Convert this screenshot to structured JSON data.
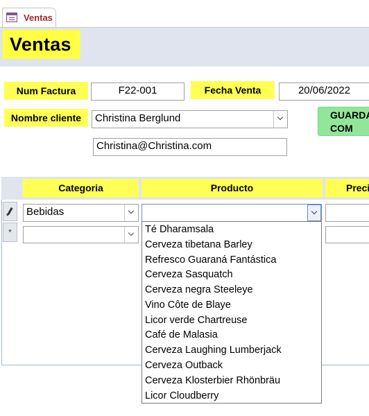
{
  "tab": {
    "label": "Ventas"
  },
  "form": {
    "title": "Ventas"
  },
  "invoice": {
    "num_label": "Num Factura",
    "num_value": "F22-001",
    "date_label": "Fecha Venta",
    "date_value": "20/06/2022",
    "client_label": "Nombre cliente",
    "client_value": "Christina Berglund",
    "email_value": "Christina@Christina.com",
    "save_label": "GUARDA\nCOM"
  },
  "subform": {
    "columns": [
      "Categoria",
      "Producto",
      "Preci"
    ],
    "row1": {
      "categoria": "Bebidas",
      "producto": ""
    },
    "new_row_symbol": "*"
  },
  "product_dropdown": {
    "items": [
      "Té Dharamsala",
      "Cerveza tibetana Barley",
      "Refresco Guaraná Fantástica",
      "Cerveza Sasquatch",
      "Cerveza negra Steeleye",
      "Vino Côte de Blaye",
      "Licor verde Chartreuse",
      "Café de Malasia",
      "Cerveza Laughing Lumberjack",
      "Cerveza Outback",
      "Cerveza Klosterbier Rhönbräu",
      "Licor Cloudberry"
    ]
  }
}
